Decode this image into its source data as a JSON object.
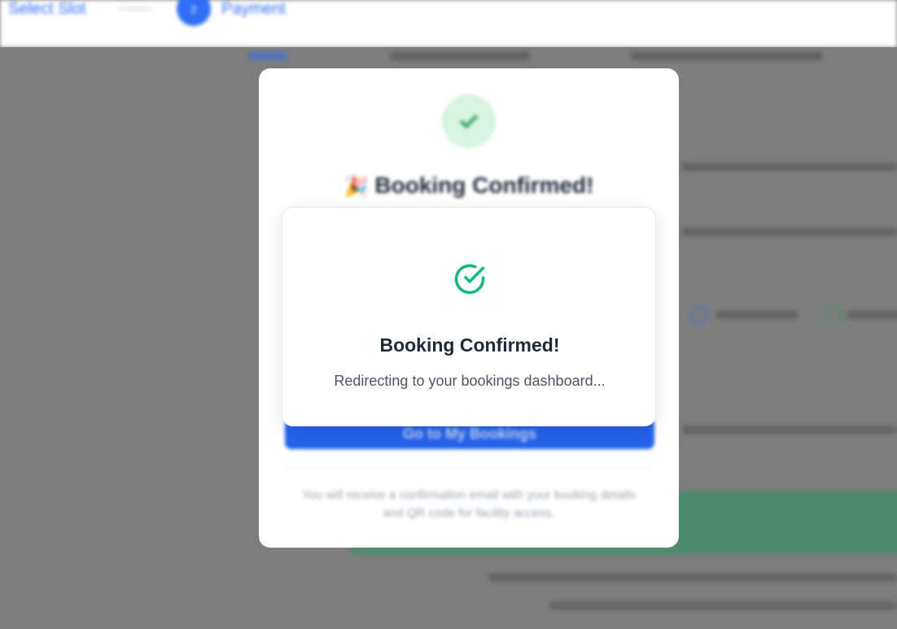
{
  "stepper": {
    "step1_label": "Select Slot",
    "step2_number": "2",
    "step2_label": "Payment"
  },
  "modal_back": {
    "icon": "check-icon",
    "emoji": "🎉",
    "title": "Booking Confirmed!",
    "primary_button": "Go to My Bookings",
    "note": "You will receive a confirmation email with your booking details and QR code for facility access."
  },
  "confirm_card": {
    "icon": "check-circle-icon",
    "title": "Booking Confirmed!",
    "subtitle": "Redirecting to your bookings dashboard..."
  },
  "colors": {
    "accent": "#2563eb",
    "success": "#10b981",
    "overlay": "#7e7e7e"
  }
}
